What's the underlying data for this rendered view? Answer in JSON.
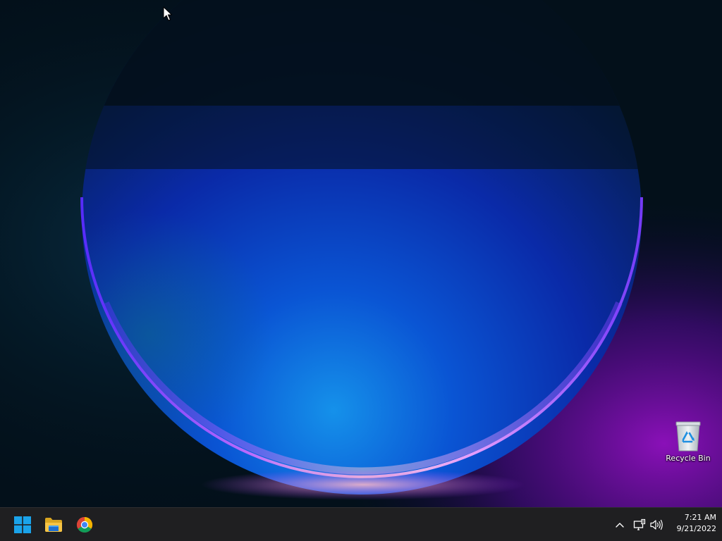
{
  "desktop": {
    "icons": [
      {
        "label": "Recycle Bin",
        "icon": "recycle-bin-icon"
      }
    ]
  },
  "taskbar": {
    "pinned": [
      {
        "name": "start",
        "icon": "windows-logo-icon"
      },
      {
        "name": "file-explorer",
        "icon": "folder-icon"
      },
      {
        "name": "chrome",
        "icon": "chrome-icon"
      }
    ],
    "tray": {
      "icons": [
        "chevron-up-icon",
        "network-icon",
        "volume-icon"
      ]
    },
    "clock": {
      "time": "7:21 AM",
      "date": "9/21/2022"
    }
  },
  "colors": {
    "taskbar_bg": "#1f1f21",
    "windows_blue": "#1aa3ea",
    "folder_yellow": "#f6c445"
  }
}
